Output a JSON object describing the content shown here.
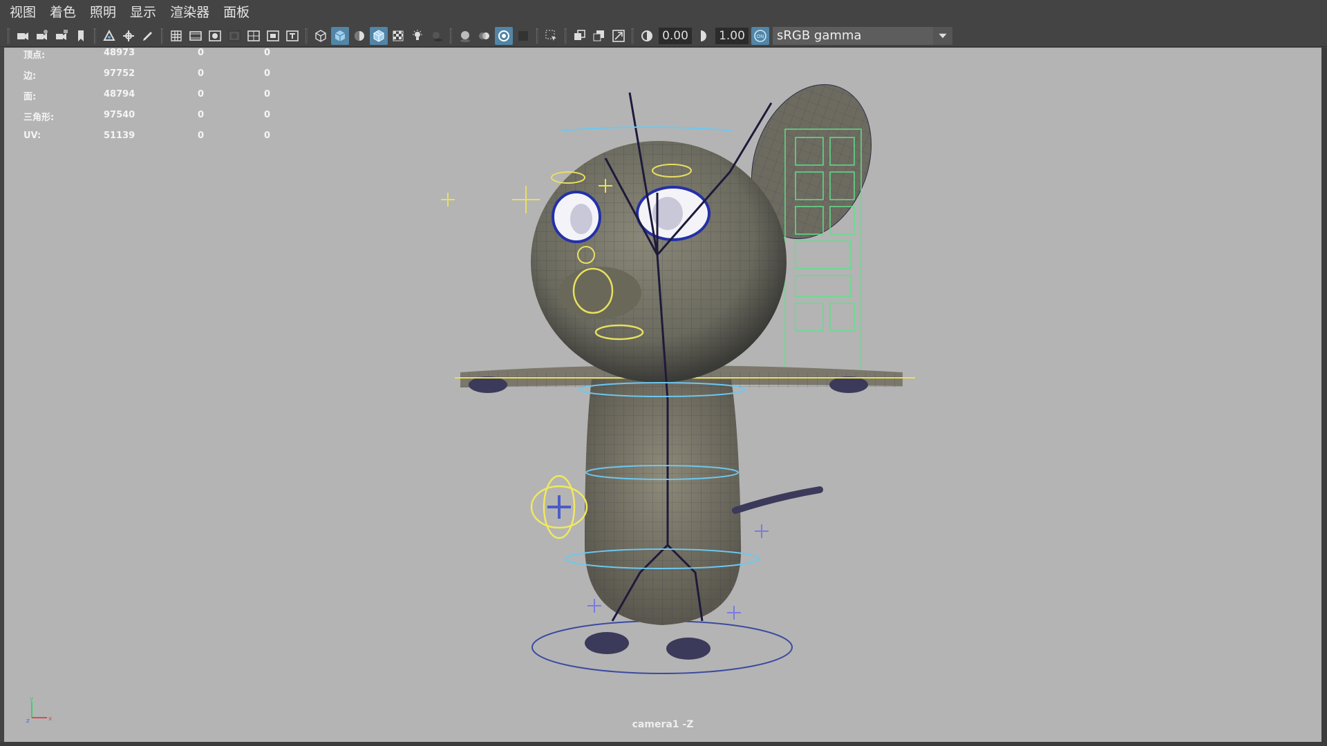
{
  "menu": {
    "items": [
      "视图",
      "着色",
      "照明",
      "显示",
      "渲染器",
      "面板"
    ]
  },
  "toolbar": {
    "exposure_value": "0.00",
    "gamma_value": "1.00",
    "color_space": "sRGB gamma",
    "icons": [
      "camera-select-icon",
      "camera-attributes-icon",
      "camera-lock-icon",
      "bookmark-icon",
      "image-plane-icon",
      "pan-zoom-icon",
      "grease-pencil-icon",
      "grid-icon",
      "film-gate-icon",
      "resolution-gate-icon",
      "gate-mask-icon",
      "field-chart-icon",
      "safe-action-icon",
      "safe-title-icon",
      "wireframe-icon",
      "smooth-shade-icon",
      "default-material-icon",
      "wireframe-on-shaded-icon",
      "xray-icon",
      "use-lights-icon",
      "shadows-icon",
      "screen-space-ao-icon",
      "motion-blur-icon",
      "anti-aliasing-icon",
      "depth-of-field-icon",
      "isolate-select-icon",
      "xray-active-icon",
      "xray-joints-icon",
      "backface-icon",
      "exposure-icon",
      "gamma-icon",
      "color-management-icon"
    ],
    "accent": "#5285a6"
  },
  "hud": {
    "rows": [
      {
        "label": "顶点:",
        "v1": "48973",
        "v2": "0",
        "v3": "0"
      },
      {
        "label": "边:",
        "v1": "97752",
        "v2": "0",
        "v3": "0"
      },
      {
        "label": "面:",
        "v1": "48794",
        "v2": "0",
        "v3": "0"
      },
      {
        "label": "三角形:",
        "v1": "97540",
        "v2": "0",
        "v3": "0"
      },
      {
        "label": "UV:",
        "v1": "51139",
        "v2": "0",
        "v3": "0"
      }
    ]
  },
  "viewport": {
    "camera_label": "camera1 -Z",
    "axis_y": "y",
    "axis_x": "x",
    "axis_z": "z",
    "background": "#b4b4b4"
  }
}
